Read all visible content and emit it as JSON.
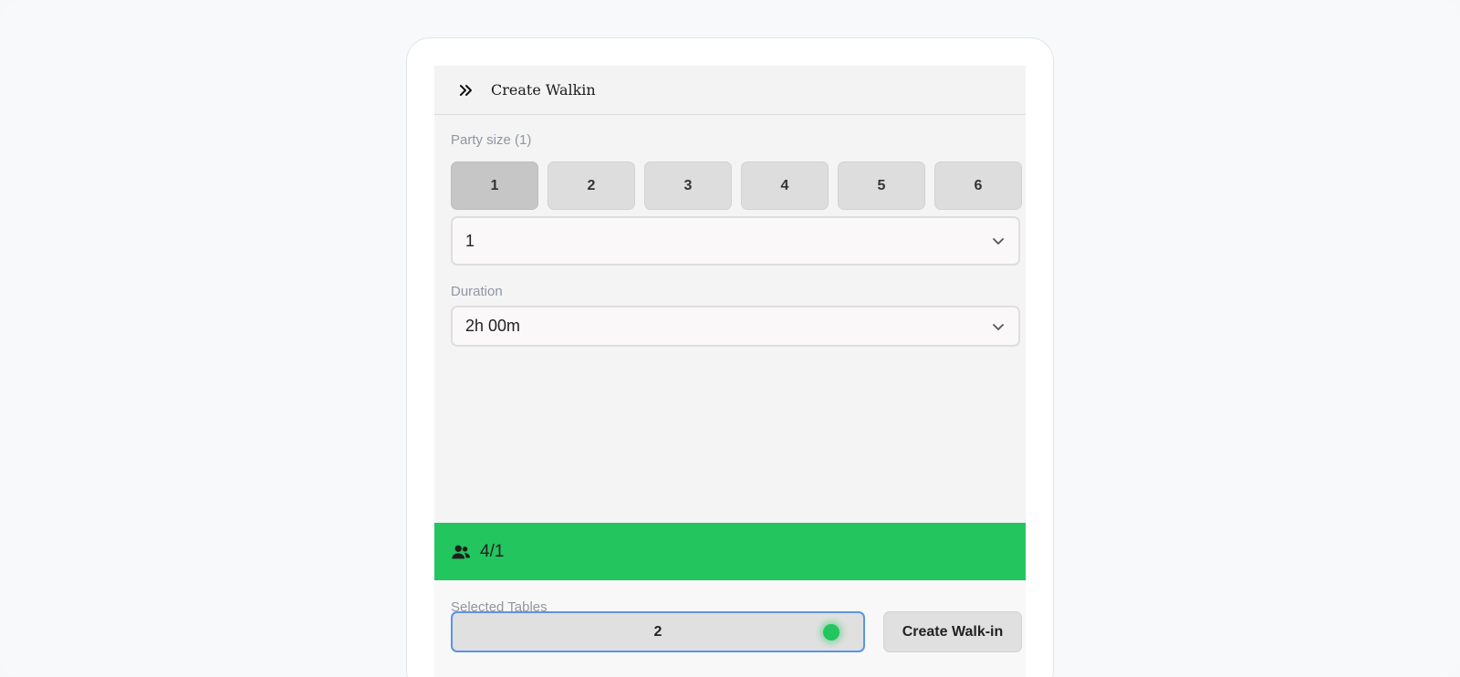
{
  "header": {
    "title": "Create Walkin",
    "toggle_icon": "double-chevron-right-icon"
  },
  "party_size": {
    "label": "Party size (1)",
    "options": [
      "1",
      "2",
      "3",
      "4",
      "5",
      "6"
    ],
    "selected": "1",
    "select_value": "1"
  },
  "duration": {
    "label": "Duration",
    "value": "2h 00m"
  },
  "capacity": {
    "icon": "users-icon",
    "text": "4/1",
    "color": "#22c55e"
  },
  "selected_tables": {
    "label": "Selected Tables",
    "table": "2",
    "status_color": "#22c55e"
  },
  "actions": {
    "create_label": "Create Walk-in"
  }
}
